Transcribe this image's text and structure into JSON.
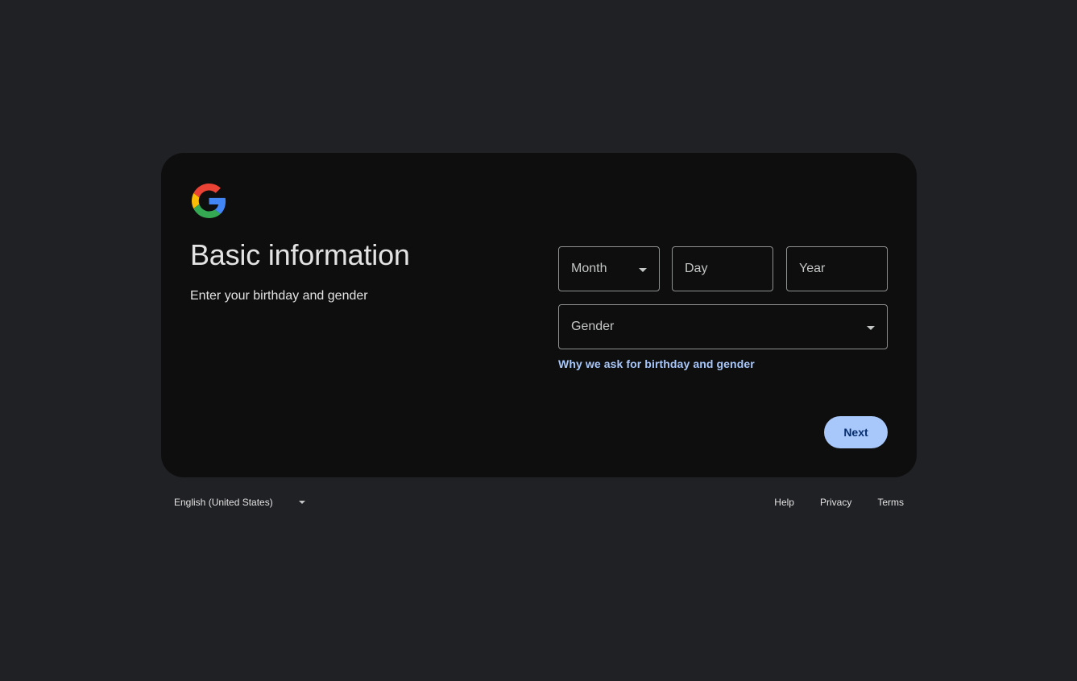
{
  "logo": {
    "icon": "google-g-icon",
    "colors": [
      "#4285F4",
      "#EA4335",
      "#FBBC05",
      "#34A853"
    ]
  },
  "header": {
    "title": "Basic information",
    "subtitle": "Enter your birthday and gender"
  },
  "form": {
    "month": {
      "label": "Month",
      "icon": "chevron-down-icon"
    },
    "day": {
      "placeholder": "Day",
      "value": ""
    },
    "year": {
      "placeholder": "Year",
      "value": ""
    },
    "gender": {
      "label": "Gender",
      "icon": "chevron-down-icon"
    },
    "why_link": "Why we ask for birthday and gender",
    "next_label": "Next"
  },
  "footer": {
    "language": "English (United States)",
    "links": {
      "help": "Help",
      "privacy": "Privacy",
      "terms": "Terms"
    }
  },
  "colors": {
    "background": "#202124",
    "card": "#0e0e0e",
    "accent": "#a8c7fa",
    "accent_text": "#062e6f"
  }
}
